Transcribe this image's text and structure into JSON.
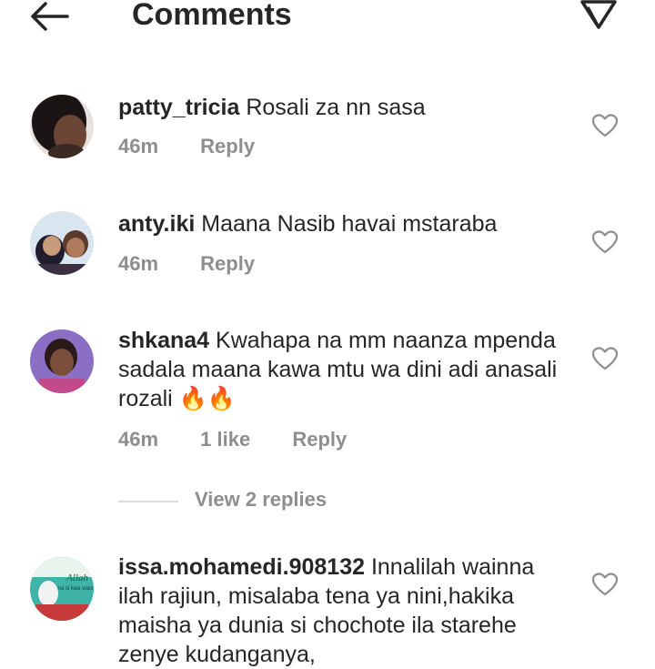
{
  "header": {
    "title": "Comments",
    "back_icon": "arrow-left-icon",
    "send_icon": "send-icon"
  },
  "comments": [
    {
      "username": "patty_tricia",
      "text": "Rosali za nn sasa",
      "time": "46m",
      "reply_label": "Reply"
    },
    {
      "username": "anty.iki",
      "text": "Maana Nasib havai mstaraba",
      "time": "46m",
      "reply_label": "Reply"
    },
    {
      "username": "shkana4",
      "text": "Kwahapa na mm naanza mpenda sadala maana kawa mtu wa dini adi anasali rozali 🔥🔥",
      "time": "46m",
      "likes": "1 like",
      "reply_label": "Reply"
    },
    {
      "username": "issa.mohamedi.908132",
      "text": "Innalilah wainna ilah rajiun, misalaba tena ya nini,hakika maisha ya dunia si chochote ila starehe zenye kudanganya,"
    }
  ],
  "view_replies": "View 2 replies",
  "avatar4_text": {
    "line1": "Allah",
    "line2": "na si kwa wats"
  },
  "colors": {
    "text": "#262626",
    "secondary": "#8e8e8e",
    "divider": "#dbdbdb"
  }
}
